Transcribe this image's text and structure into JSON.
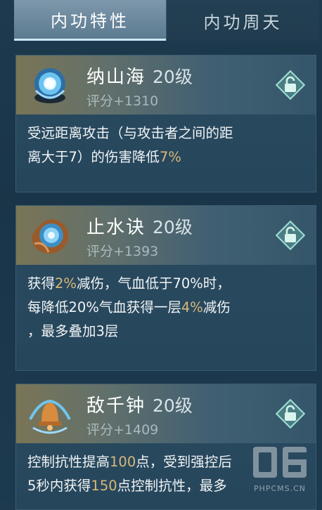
{
  "tabs": [
    {
      "label": "内功特性",
      "active": true
    },
    {
      "label": "内功周天",
      "active": false
    }
  ],
  "cards": [
    {
      "name": "纳山海",
      "level": "20级",
      "score": "评分+1310",
      "icon": "blue-orb-icon",
      "lines": [
        [
          {
            "t": "受远距离攻击（与攻击者之间的距"
          }
        ],
        [
          {
            "t": "离大于7）的伤害降低"
          },
          {
            "t": "7%",
            "hl": true
          }
        ]
      ]
    },
    {
      "name": "止水诀",
      "level": "20级",
      "score": "评分+1393",
      "icon": "flame-orb-icon",
      "lines": [
        [
          {
            "t": "获得"
          },
          {
            "t": "2%",
            "hl": true
          },
          {
            "t": "减伤，气血低于70%时，"
          }
        ],
        [
          {
            "t": "每降低20%气血获得一层"
          },
          {
            "t": "4%",
            "hl": true
          },
          {
            "t": "减伤"
          }
        ],
        [
          {
            "t": "，最多叠加3层"
          }
        ]
      ]
    },
    {
      "name": "敌千钟",
      "level": "20级",
      "score": "评分+1409",
      "icon": "bell-icon",
      "lines": [
        [
          {
            "t": "控制抗性提高"
          },
          {
            "t": "100",
            "hl": true
          },
          {
            "t": "点，受到强控后"
          }
        ],
        [
          {
            "t": "5秒内获得"
          },
          {
            "t": "150",
            "hl": true
          },
          {
            "t": "点控制抗性，最多"
          }
        ]
      ]
    }
  ],
  "colors": {
    "highlight": "#d8b87a",
    "background": "#1c3a4f"
  },
  "watermark": {
    "text": "PHPCMS.CN"
  }
}
